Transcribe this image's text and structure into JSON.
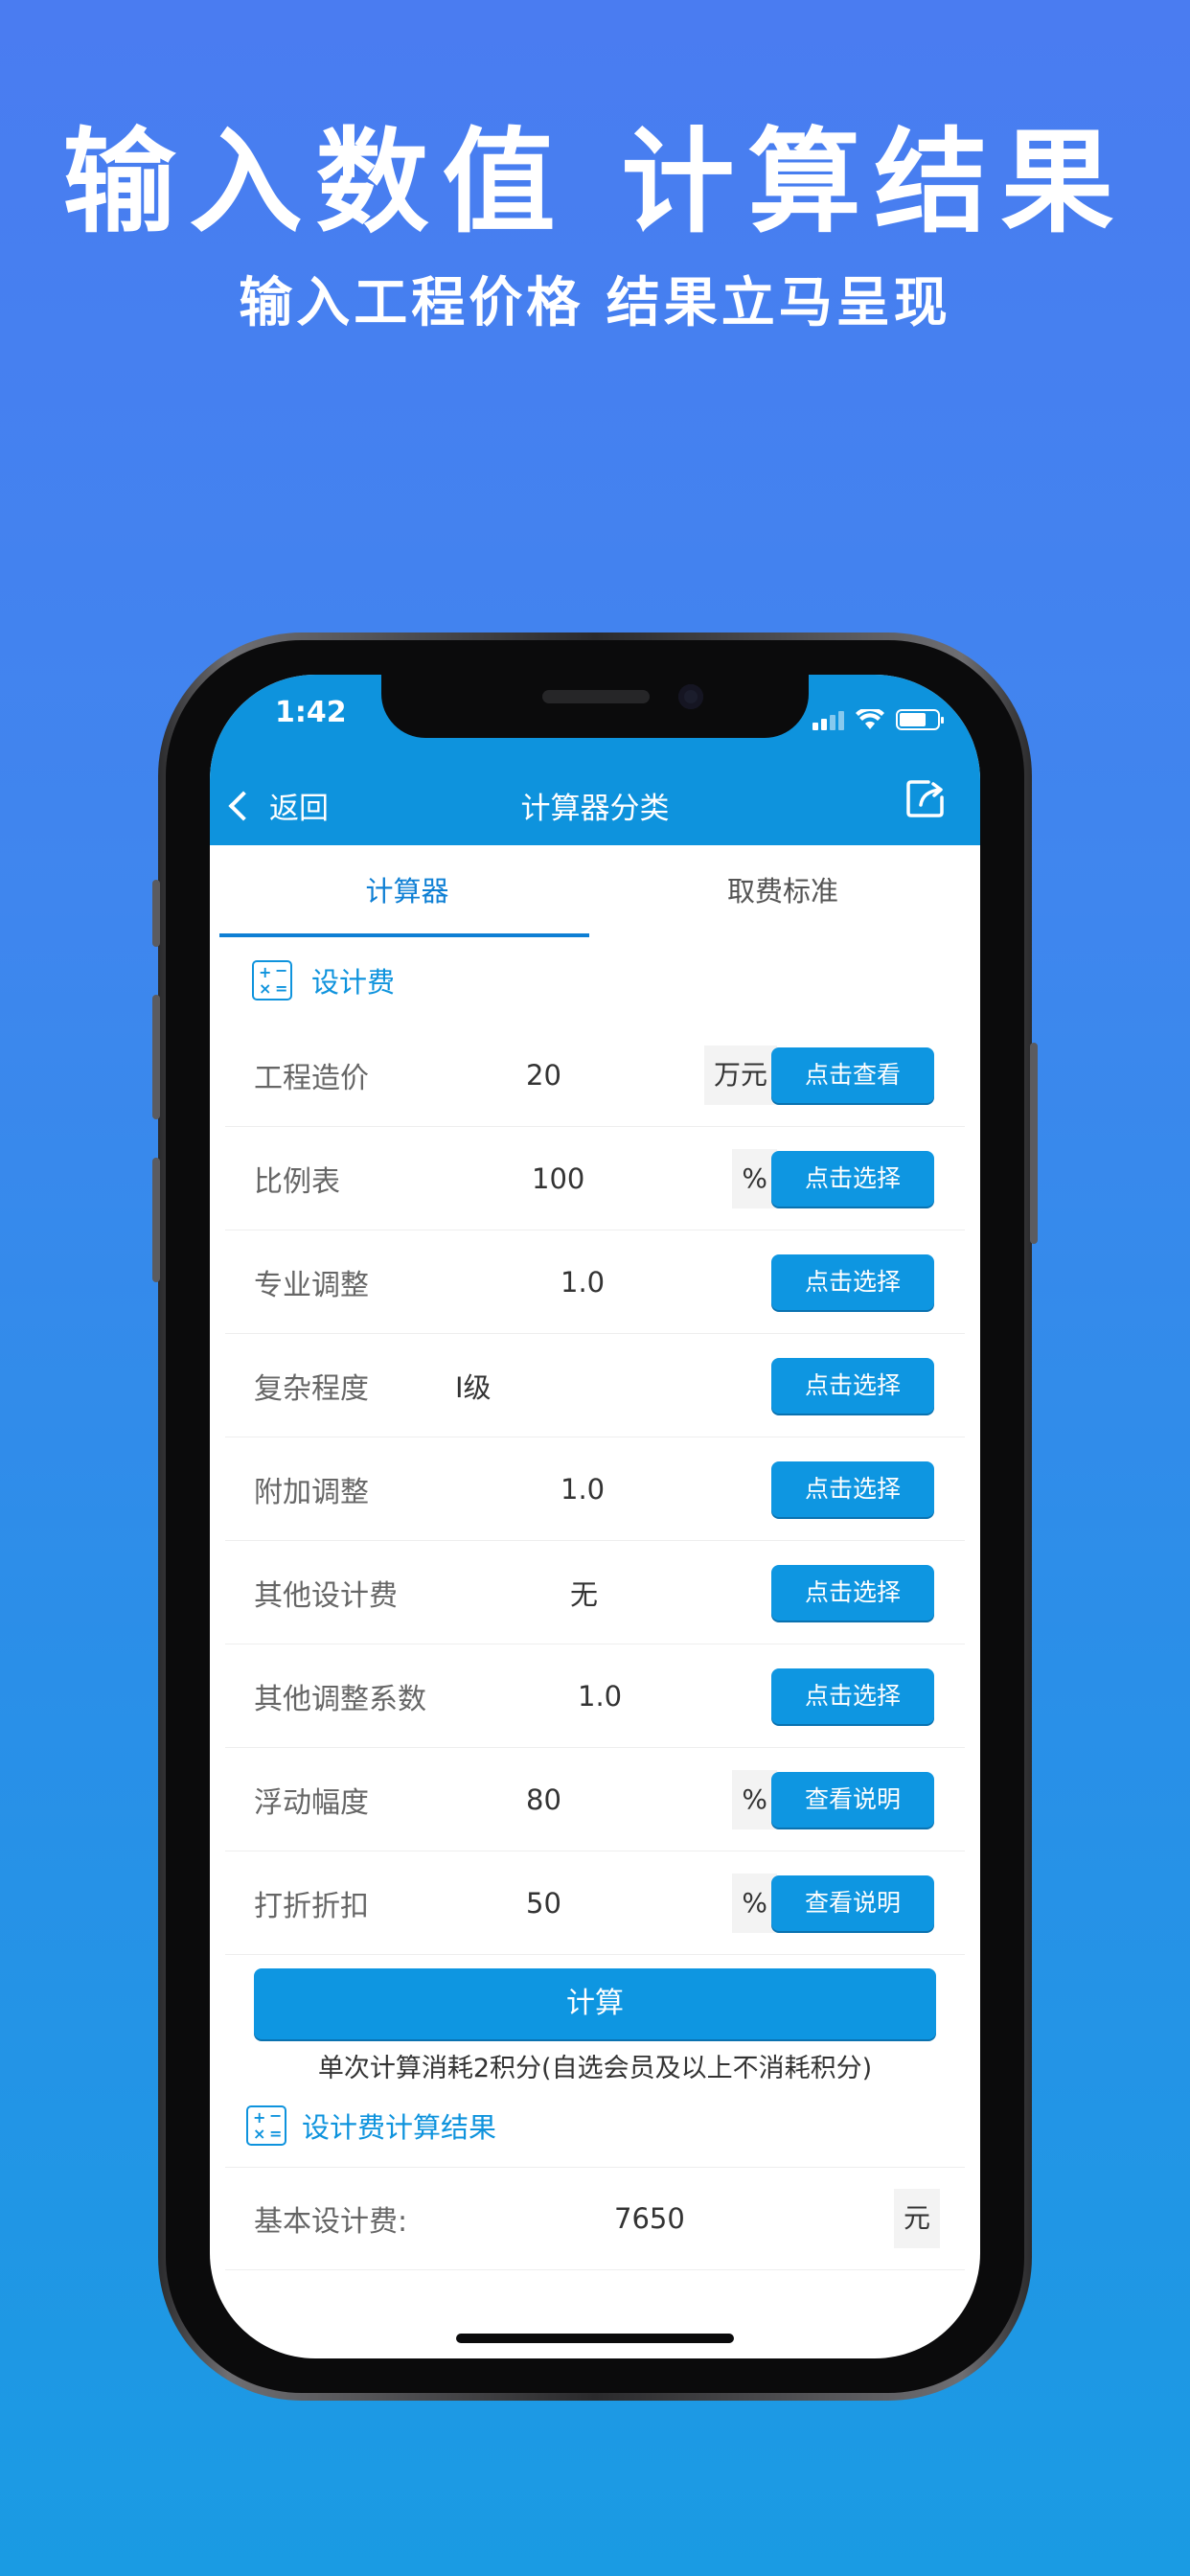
{
  "promo": {
    "headline": "输入数值 计算结果",
    "subline": "输入工程价格 结果立马呈现"
  },
  "status": {
    "time": "1:42"
  },
  "nav": {
    "back_label": "返回",
    "title": "计算器分类",
    "share_icon": "share-icon"
  },
  "tabs": [
    {
      "label": "计算器",
      "active": true
    },
    {
      "label": "取费标准",
      "active": false
    }
  ],
  "section": {
    "title": "设计费",
    "icon": "calculator-icon"
  },
  "rows": [
    {
      "label": "工程造价",
      "value": "20",
      "unit": "万元",
      "button": "点击查看"
    },
    {
      "label": "比例表",
      "value": "100",
      "unit": "%",
      "button": "点击选择"
    },
    {
      "label": "专业调整",
      "value": "1.0",
      "unit": "",
      "button": "点击选择"
    },
    {
      "label": "复杂程度",
      "value": "Ⅰ级",
      "unit": "",
      "button": "点击选择"
    },
    {
      "label": "附加调整",
      "value": "1.0",
      "unit": "",
      "button": "点击选择"
    },
    {
      "label": "其他设计费",
      "value": "无",
      "unit": "",
      "button": "点击选择"
    },
    {
      "label": "其他调整系数",
      "value": "1.0",
      "unit": "",
      "button": "点击选择"
    },
    {
      "label": "浮动幅度",
      "value": "80",
      "unit": "%",
      "button": "查看说明"
    },
    {
      "label": "打折折扣",
      "value": "50",
      "unit": "%",
      "button": "查看说明"
    }
  ],
  "calculate": {
    "button_label": "计算",
    "note": "单次计算消耗2积分(自选会员及以上不消耗积分)"
  },
  "result": {
    "title": "设计费计算结果",
    "rows": [
      {
        "label": "基本设计费:",
        "value": "7650",
        "unit": "元"
      }
    ]
  },
  "colors": {
    "accent": "#0e93dd",
    "button": "#0e96e1",
    "background_top": "#4a7cf1",
    "background_bottom": "#1a9be3"
  }
}
